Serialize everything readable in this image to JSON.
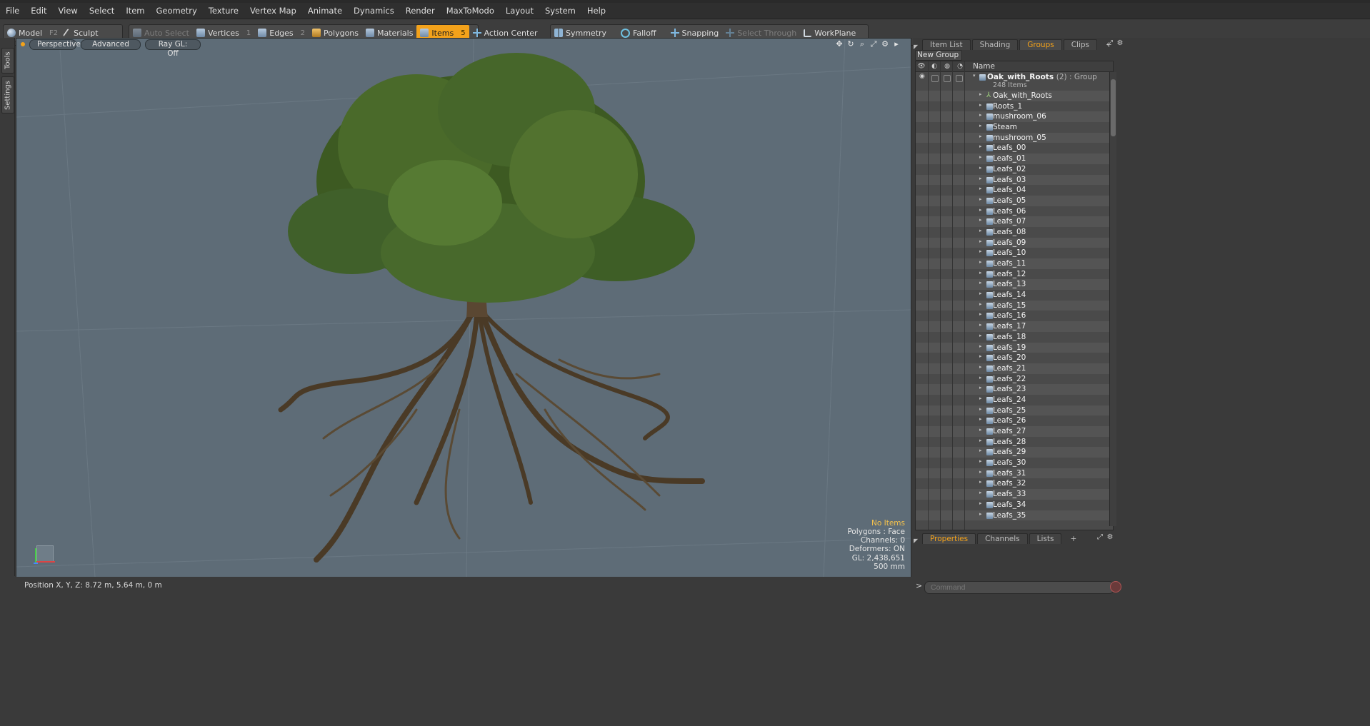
{
  "menu": [
    "File",
    "Edit",
    "View",
    "Select",
    "Item",
    "Geometry",
    "Texture",
    "Vertex Map",
    "Animate",
    "Dynamics",
    "Render",
    "MaxToModo",
    "Layout",
    "System",
    "Help"
  ],
  "toolbar": {
    "model": "Model",
    "model_key": "F2",
    "sculpt": "Sculpt",
    "auto_select": "Auto Select",
    "vertices": "Vertices",
    "vertices_key": "1",
    "edges": "Edges",
    "edges_key": "2",
    "polygons": "Polygons",
    "materials": "Materials",
    "items": "Items",
    "items_key": "5",
    "action_center": "Action Center",
    "symmetry": "Symmetry",
    "falloff": "Falloff",
    "snapping": "Snapping",
    "select_through": "Select Through",
    "workplane": "WorkPlane"
  },
  "side_tabs": [
    "Tools",
    "Settings"
  ],
  "viewport": {
    "view": "Perspective",
    "style": "Advanced",
    "raygl": "Ray GL: Off",
    "info": {
      "items": "No Items",
      "polygons": "Polygons : Face",
      "channels": "Channels: 0",
      "deformers": "Deformers: ON",
      "gl": "GL: 2,438,651",
      "scale": "500 mm"
    }
  },
  "status": {
    "position": "Position X, Y, Z:   8.72 m, 5.64 m, 0 m"
  },
  "panel": {
    "tabs": [
      "Item List",
      "Shading",
      "Groups",
      "Clips"
    ],
    "active_tab": "Groups",
    "new_group": "New Group",
    "name_header": "Name",
    "group": {
      "name": "Oak_with_Roots",
      "meta": "(2) : Group",
      "count": "248 Items"
    },
    "items": [
      "Oak_with_Roots",
      "Roots_1",
      "mushroom_06",
      "Steam",
      "mushroom_05",
      "Leafs_00",
      "Leafs_01",
      "Leafs_02",
      "Leafs_03",
      "Leafs_04",
      "Leafs_05",
      "Leafs_06",
      "Leafs_07",
      "Leafs_08",
      "Leafs_09",
      "Leafs_10",
      "Leafs_11",
      "Leafs_12",
      "Leafs_13",
      "Leafs_14",
      "Leafs_15",
      "Leafs_16",
      "Leafs_17",
      "Leafs_18",
      "Leafs_19",
      "Leafs_20",
      "Leafs_21",
      "Leafs_22",
      "Leafs_23",
      "Leafs_24",
      "Leafs_25",
      "Leafs_26",
      "Leafs_27",
      "Leafs_28",
      "Leafs_29",
      "Leafs_30",
      "Leafs_31",
      "Leafs_32",
      "Leafs_33",
      "Leafs_34",
      "Leafs_35"
    ],
    "bottom_tabs": [
      "Properties",
      "Channels",
      "Lists"
    ],
    "command_placeholder": "Command"
  },
  "colors": {
    "accent": "#f3a21b",
    "viewport_bg": "#5e6c77",
    "panel_bg": "#3a3a3a"
  }
}
